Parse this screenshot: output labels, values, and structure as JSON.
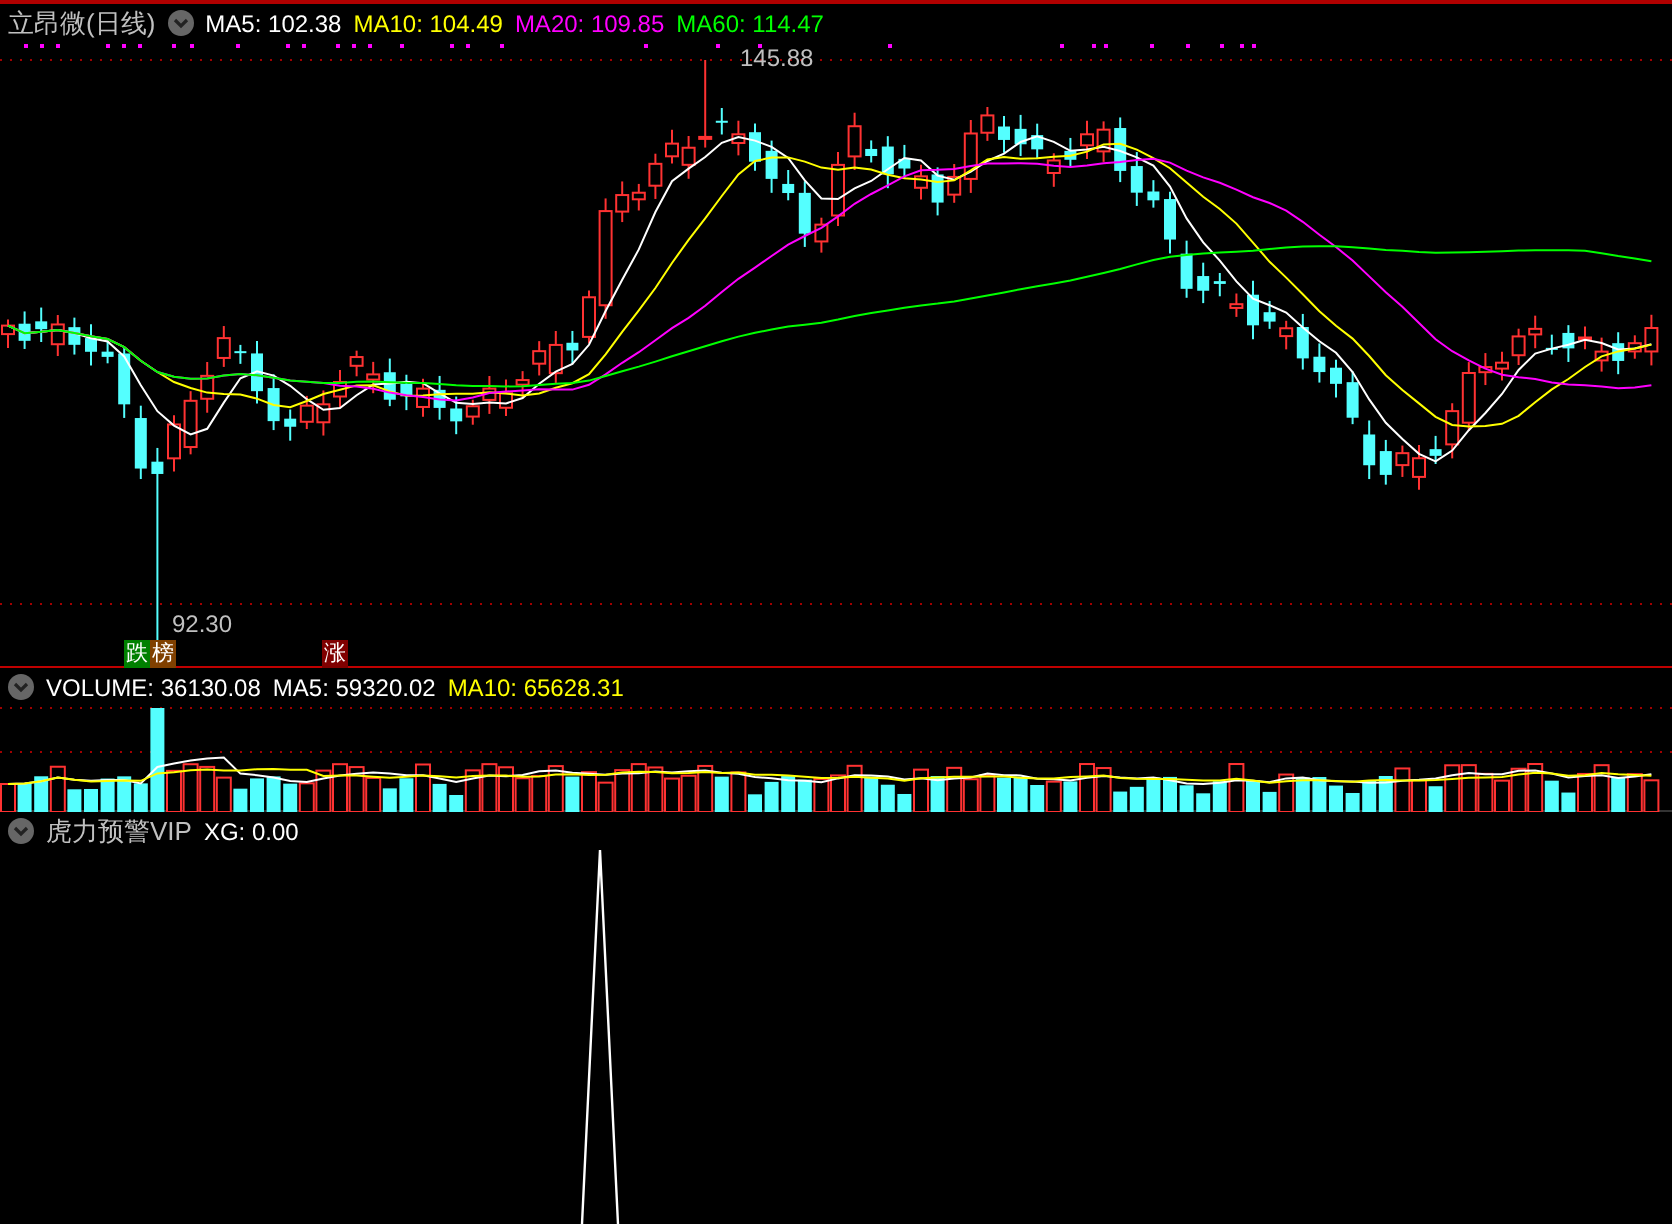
{
  "price_panel": {
    "title": "立昂微(日线)",
    "legend": [
      {
        "label": "MA5: 102.38",
        "color": "#ffffff"
      },
      {
        "label": "MA10: 104.49",
        "color": "#ffff00"
      },
      {
        "label": "MA20: 109.85",
        "color": "#ff00ff"
      },
      {
        "label": "MA60: 114.47",
        "color": "#00ff00"
      }
    ],
    "high_label": "145.88",
    "low_label": "92.30",
    "badges": [
      {
        "text": "跌",
        "color": "#008000"
      },
      {
        "text": "榜",
        "color": "#804000"
      },
      {
        "text": "涨",
        "color": "#800000"
      }
    ]
  },
  "volume_panel": {
    "legend": [
      {
        "label": "VOLUME: 36130.08",
        "color": "#ffffff"
      },
      {
        "label": "MA5: 59320.02",
        "color": "#ffffff"
      },
      {
        "label": "MA10: 65628.31",
        "color": "#ffff00"
      }
    ]
  },
  "indicator_panel": {
    "title": "虎力预警VIP",
    "legend": [
      {
        "label": "XG: 0.00",
        "color": "#ffffff"
      }
    ]
  }
}
